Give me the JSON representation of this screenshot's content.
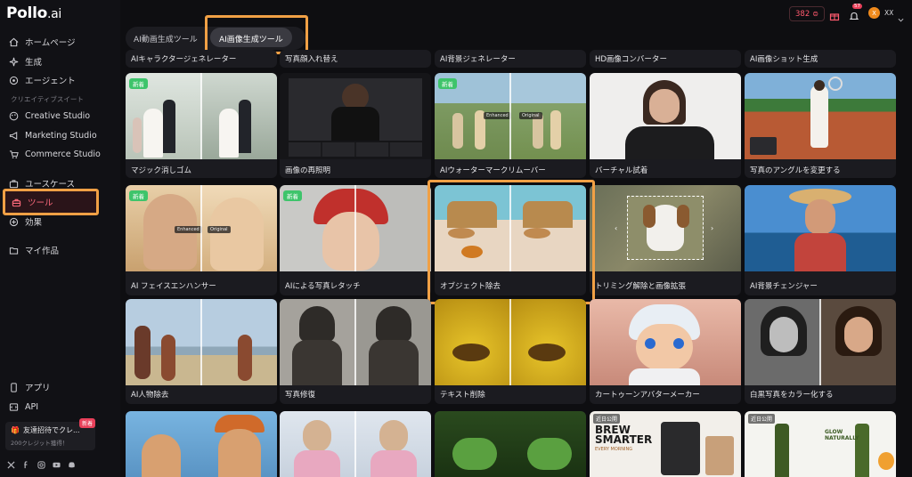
{
  "app": {
    "logo": "Pollo",
    "logo_suffix": ".ai"
  },
  "sidebar": {
    "items": [
      {
        "label": "ホームページ",
        "icon": "home-icon"
      },
      {
        "label": "生成",
        "icon": "sparkle-icon"
      },
      {
        "label": "エージェント",
        "icon": "agent-icon"
      }
    ],
    "section_title": "クリエイティブスイート",
    "studios": [
      {
        "label": "Creative Studio",
        "icon": "palette-icon"
      },
      {
        "label": "Marketing Studio",
        "icon": "megaphone-icon"
      },
      {
        "label": "Commerce Studio",
        "icon": "cart-icon"
      }
    ],
    "lower": [
      {
        "label": "ユースケース",
        "icon": "briefcase-icon"
      },
      {
        "label": "ツール",
        "icon": "toolbox-icon",
        "active": true
      },
      {
        "label": "効果",
        "icon": "effects-icon"
      }
    ],
    "my_works": {
      "label": "マイ作品",
      "icon": "folder-icon"
    },
    "footer": [
      {
        "label": "アプリ",
        "icon": "phone-icon"
      },
      {
        "label": "API",
        "icon": "api-icon"
      }
    ],
    "invite": {
      "title": "友達招待でクレ...",
      "subtitle": "200クレジット獲得！",
      "badge": "新着"
    },
    "social_icons": [
      "x-icon",
      "facebook-icon",
      "instagram-icon",
      "youtube-icon",
      "discord-icon"
    ]
  },
  "topbar": {
    "credits": "382",
    "notification_count": "57",
    "avatar_initial": "X",
    "user_name": "XX"
  },
  "tabs": [
    {
      "label": "AI動画生成ツール",
      "active": false
    },
    {
      "label": "AI画像生成ツール",
      "active": true
    }
  ],
  "top_row_labels": [
    "AIキャラクタージェネレーター",
    "写真顔入れ替え",
    "AI背景ジェネレーター",
    "HD画像コンバーター",
    "AI画像ショット生成"
  ],
  "cards": [
    {
      "label": "マジック消しゴム",
      "badge": "新着"
    },
    {
      "label": "画像の再照明",
      "badge": ""
    },
    {
      "label": "AIウォーターマークリムーバー",
      "badge": "新着"
    },
    {
      "label": "バーチャル試着",
      "badge": ""
    },
    {
      "label": "写真のアングルを変更する",
      "badge": ""
    },
    {
      "label": "AI フェイスエンハンサー",
      "badge": "新着"
    },
    {
      "label": "AIによる写真レタッチ",
      "badge": "新着"
    },
    {
      "label": "オブジェクト除去",
      "badge": ""
    },
    {
      "label": "トリミング解除と画像拡張",
      "badge": ""
    },
    {
      "label": "AI背景チェンジャー",
      "badge": ""
    },
    {
      "label": "AI人物除去",
      "badge": ""
    },
    {
      "label": "写真修復",
      "badge": ""
    },
    {
      "label": "テキスト削除",
      "badge": ""
    },
    {
      "label": "カートゥーンアバターメーカー",
      "badge": ""
    },
    {
      "label": "白黒写真をカラー化する",
      "badge": ""
    }
  ],
  "bottom_row": [
    {
      "tag": ""
    },
    {
      "tag": ""
    },
    {
      "tag": ""
    },
    {
      "tag": "近日公開",
      "headline": "BREW SMARTER",
      "sub": "EVERY MORNING"
    },
    {
      "tag": "近日公開",
      "headline": "GLOW NATURALLY"
    }
  ],
  "image_chips": {
    "enhanced": "Enhanced",
    "original": "Original"
  },
  "colors": {
    "accent": "#ff5a6e",
    "highlight": "#f0a045",
    "new_badge": "#3ec46b",
    "background": "#0e0e11"
  }
}
